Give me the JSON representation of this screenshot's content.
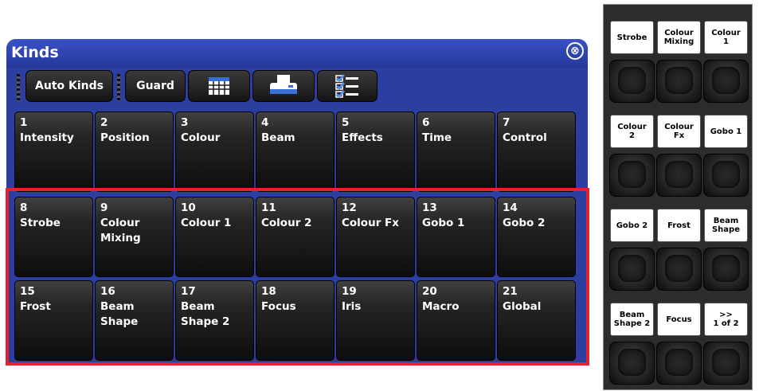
{
  "window": {
    "title": "Kinds",
    "close_glyph": "⊗"
  },
  "toolbar": {
    "auto_kinds_label": "Auto Kinds",
    "guard_label": "Guard",
    "icons": [
      "grid-view-icon",
      "printer-icon",
      "checklist-icon"
    ]
  },
  "kinds": [
    {
      "num": "1",
      "label": "Intensity"
    },
    {
      "num": "2",
      "label": "Position"
    },
    {
      "num": "3",
      "label": "Colour"
    },
    {
      "num": "4",
      "label": "Beam"
    },
    {
      "num": "5",
      "label": "Effects"
    },
    {
      "num": "6",
      "label": "Time"
    },
    {
      "num": "7",
      "label": "Control"
    },
    {
      "num": "8",
      "label": "Strobe"
    },
    {
      "num": "9",
      "label": "Colour\nMixing"
    },
    {
      "num": "10",
      "label": "Colour 1"
    },
    {
      "num": "11",
      "label": "Colour 2"
    },
    {
      "num": "12",
      "label": "Colour Fx"
    },
    {
      "num": "13",
      "label": "Gobo 1"
    },
    {
      "num": "14",
      "label": "Gobo 2"
    },
    {
      "num": "15",
      "label": "Frost"
    },
    {
      "num": "16",
      "label": "Beam\nShape"
    },
    {
      "num": "17",
      "label": "Beam\nShape 2"
    },
    {
      "num": "18",
      "label": "Focus"
    },
    {
      "num": "19",
      "label": "Iris"
    },
    {
      "num": "20",
      "label": "Macro"
    },
    {
      "num": "21",
      "label": "Global"
    }
  ],
  "side_panel": {
    "labels": [
      "Strobe",
      "Colour\nMixing",
      "Colour\n1",
      "Colour\n2",
      "Colour\nFx",
      "Gobo 1",
      "Gobo 2",
      "Frost",
      "Beam\nShape",
      "Beam\nShape 2",
      "Focus",
      ">>\n1 of 2"
    ]
  },
  "colors": {
    "window_blue": "#2c3fa1",
    "highlight_red": "#e4222c",
    "button_dark": "#1a1a1a"
  }
}
